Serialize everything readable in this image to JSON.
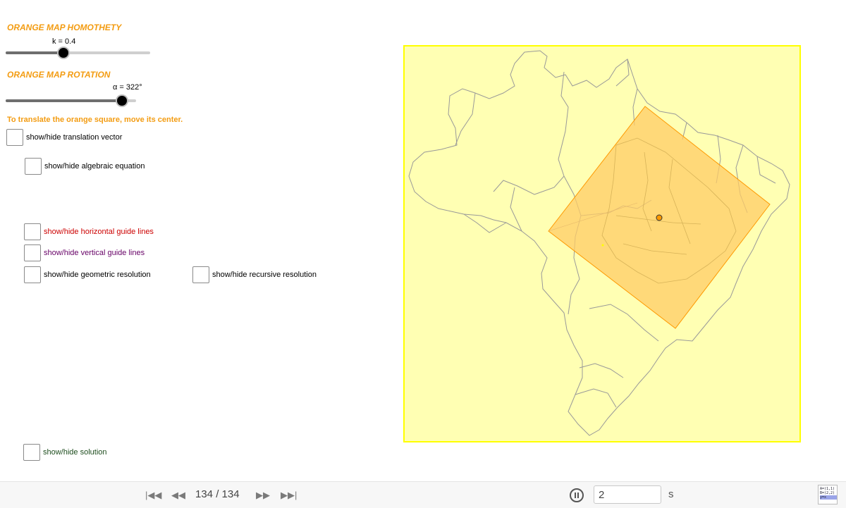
{
  "panel": {
    "homothety_title": "ORANGE MAP HOMOTHETY",
    "k_label": "k = 0.4",
    "k_value": 0.4,
    "rotation_title": "ORANGE MAP ROTATION",
    "alpha_label": "α = 322°",
    "alpha_value": 322,
    "translate_instruction": "To translate the orange square, move its center.",
    "checkboxes": [
      {
        "label": "show/hide translation vector",
        "color": "#000000",
        "checked": false
      },
      {
        "label": "show/hide algebraic equation",
        "color": "#000000",
        "checked": false
      },
      {
        "label": "show/hide horizontal guide lines",
        "color": "#cc0000",
        "checked": false
      },
      {
        "label": "show/hide vertical guide lines",
        "color": "#660066",
        "checked": false
      },
      {
        "label": "show/hide geometric resolution",
        "color": "#000000",
        "checked": false
      },
      {
        "label": "show/hide recursive resolution",
        "color": "#000000",
        "checked": false
      },
      {
        "label": "show/hide solution",
        "color": "#1e4d1e",
        "checked": false
      }
    ]
  },
  "map": {
    "background_color": "#ffffb3",
    "frame_color": "#ffff00",
    "overlay_color": "#ffcc66",
    "overlay_stroke": "#ff9900"
  },
  "toolbar": {
    "first_icon": "skip-to-start-icon",
    "prev_icon": "step-back-icon",
    "counter": "134 / 134",
    "next_icon": "step-forward-icon",
    "last_icon": "skip-to-end-icon",
    "pause_icon": "pause-icon",
    "speed_value": "2",
    "speed_unit": "s",
    "algebra_icon": "algebra-view-icon",
    "algebra_lines": [
      "A=(1,1)",
      "B=(2,2)",
      "y=x"
    ]
  }
}
